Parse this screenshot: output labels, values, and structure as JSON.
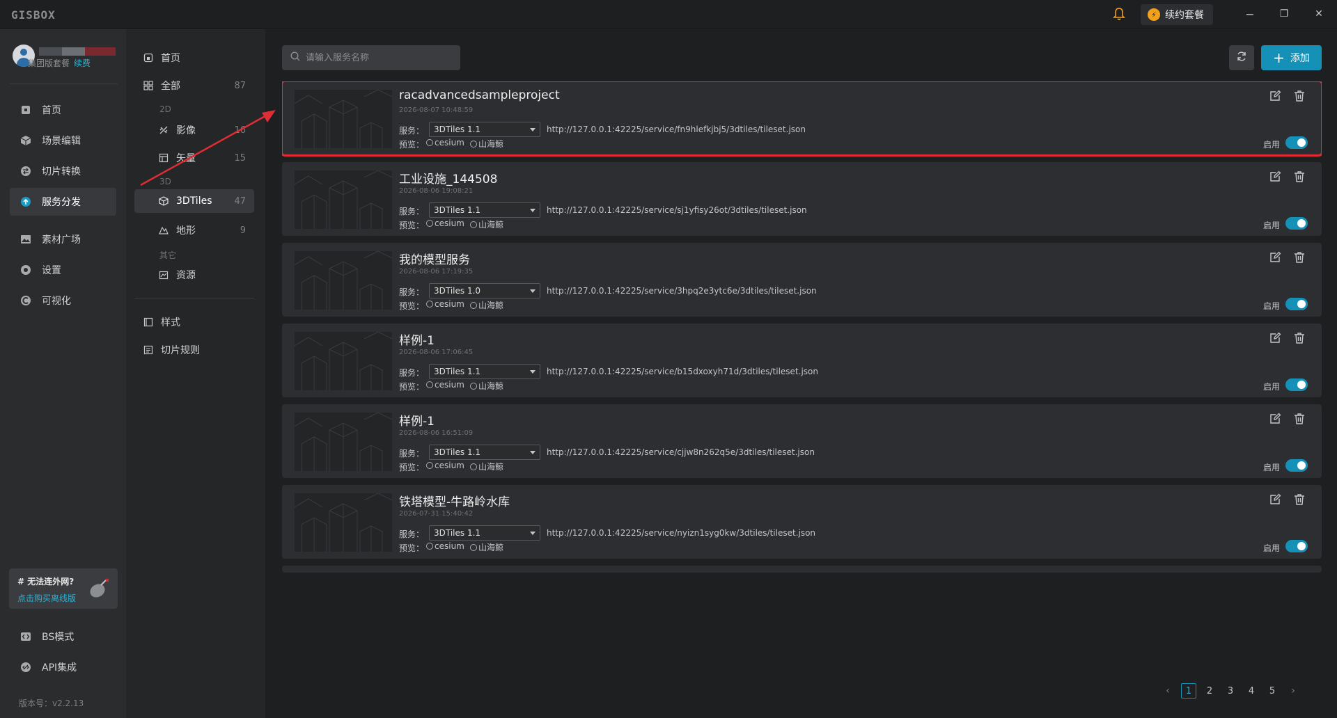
{
  "app": {
    "logo": "GISBOX"
  },
  "titlebar": {
    "renew_label": "续约套餐",
    "minimize": "−",
    "restore": "❐",
    "close": "✕"
  },
  "user": {
    "plan": "集团版套餐",
    "renew_link": "续费"
  },
  "nav": {
    "items": [
      {
        "label": "首页",
        "icon": "home-icon"
      },
      {
        "label": "场景编辑",
        "icon": "cube-icon"
      },
      {
        "label": "切片转换",
        "icon": "convert-icon"
      },
      {
        "label": "服务分发",
        "icon": "upload-cloud-icon",
        "active": true
      },
      {
        "label": "素材广场",
        "icon": "image-icon"
      },
      {
        "label": "设置",
        "icon": "gear-icon"
      },
      {
        "label": "可视化",
        "icon": "chart-icon"
      }
    ],
    "offline": {
      "title": "# 无法连外网?",
      "link": "点击购买离线版"
    },
    "bottom": [
      {
        "label": "BS模式",
        "icon": "code-icon"
      },
      {
        "label": "API集成",
        "icon": "api-icon"
      }
    ],
    "version": "版本号：v2.2.13"
  },
  "categories": {
    "home": "首页",
    "all": {
      "label": "全部",
      "count": "87"
    },
    "group_2d": "2D",
    "imagery": {
      "label": "影像",
      "count": "16"
    },
    "vector": {
      "label": "矢量",
      "count": "15"
    },
    "group_3d": "3D",
    "tiles3d": {
      "label": "3DTiles",
      "count": "47"
    },
    "terrain": {
      "label": "地形",
      "count": "9"
    },
    "group_other": "其它",
    "resource": {
      "label": "资源"
    },
    "style": {
      "label": "样式"
    },
    "slice_rules": {
      "label": "切片规则"
    }
  },
  "toolbar": {
    "search_placeholder": "请输入服务名称",
    "add_label": "添加"
  },
  "card_labels": {
    "service": "服务：",
    "preview": "预览：",
    "cesium": "cesium",
    "shanhaijing": "山海鲸",
    "enable": "启用"
  },
  "services": [
    {
      "title": "racadvancedsampleproject",
      "date": "2026-08-07 10:48:59",
      "version": "3DTiles 1.1",
      "url": "http://127.0.0.1:42225/service/fn9hlefkjbj5/3dtiles/tileset.json"
    },
    {
      "title": "工业设施_144508",
      "date": "2026-08-06 19:08:21",
      "version": "3DTiles 1.1",
      "url": "http://127.0.0.1:42225/service/sj1yfisy26ot/3dtiles/tileset.json"
    },
    {
      "title": "我的模型服务",
      "date": "2026-08-06 17:19:35",
      "version": "3DTiles 1.0",
      "url": "http://127.0.0.1:42225/service/3hpq2e3ytc6e/3dtiles/tileset.json"
    },
    {
      "title": "样例-1",
      "date": "2026-08-06 17:06:45",
      "version": "3DTiles 1.1",
      "url": "http://127.0.0.1:42225/service/b15dxoxyh71d/3dtiles/tileset.json"
    },
    {
      "title": "样例-1",
      "date": "2026-08-06 16:51:09",
      "version": "3DTiles 1.1",
      "url": "http://127.0.0.1:42225/service/cjjw8n262q5e/3dtiles/tileset.json"
    },
    {
      "title": "铁塔模型-牛路岭水库",
      "date": "2026-07-31 15:40:42",
      "version": "3DTiles 1.1",
      "url": "http://127.0.0.1:42225/service/nyizn1syg0kw/3dtiles/tileset.json"
    }
  ],
  "pager": {
    "prev": "‹",
    "next": "›",
    "pages": [
      "1",
      "2",
      "3",
      "4",
      "5"
    ]
  },
  "colors": {
    "accent": "#1591b8",
    "highlight": "#e02d35",
    "bell": "#f2a11b"
  }
}
